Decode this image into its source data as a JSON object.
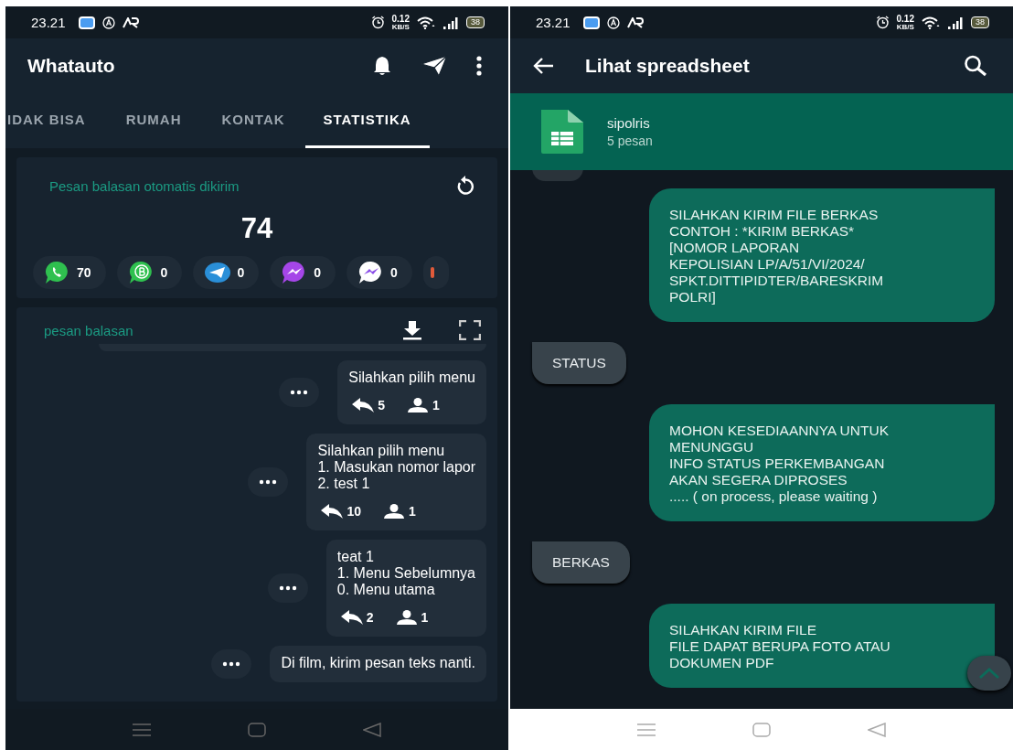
{
  "left_screen": {
    "status_bar": {
      "time": "23.21",
      "speed": "0.12",
      "speed_unit": "KB/S",
      "battery": "38"
    },
    "app_bar": {
      "title": "Whatauto"
    },
    "tabs": [
      {
        "label": "IDAK BISA",
        "selected": false
      },
      {
        "label": "RUMAH",
        "selected": false
      },
      {
        "label": "KONTAK",
        "selected": false
      },
      {
        "label": "STATISTIKA",
        "selected": true
      }
    ],
    "stats_card": {
      "title": "Pesan balasan otomatis dikirim",
      "total": "74",
      "platforms": [
        {
          "kind": "whatsapp",
          "count": "70"
        },
        {
          "kind": "business",
          "count": "0"
        },
        {
          "kind": "telegram",
          "count": "0"
        },
        {
          "kind": "messenger",
          "count": "0"
        },
        {
          "kind": "messenger_lite",
          "count": "0"
        },
        {
          "kind": "partial"
        }
      ]
    },
    "replies_card": {
      "title": "pesan balasan",
      "messages": [
        {
          "lines": [
            "Silahkan pilih menu"
          ],
          "replies": "5",
          "users": "1"
        },
        {
          "lines": [
            "Silahkan pilih menu",
            "1. Masukan nomor lapor",
            "2. test 1"
          ],
          "replies": "10",
          "users": "1"
        },
        {
          "lines": [
            "teat 1",
            "1. Menu Sebelumnya",
            "0. Menu utama"
          ],
          "replies": "2",
          "users": "1"
        },
        {
          "lines": [
            "Di film, kirim pesan teks nanti."
          ]
        }
      ]
    }
  },
  "right_screen": {
    "status_bar": {
      "time": "23.21",
      "speed": "0.12",
      "speed_unit": "KB/S",
      "battery": "38"
    },
    "app_bar": {
      "title": "Lihat spreadsheet"
    },
    "sheet": {
      "name": "sipolris",
      "count": "5 pesan"
    },
    "messages": [
      {
        "kind": "outgoing",
        "lines": [
          "SILAHKAN KIRIM FILE BERKAS",
          "CONTOH : *KIRIM BERKAS*",
          "[NOMOR LAPORAN",
          "KEPOLISIAN LP/A/51/VI/2024/",
          "SPKT.DITTIPIDTER/BARESKRIM",
          "POLRI]"
        ]
      },
      {
        "kind": "incoming",
        "lines": [
          "STATUS"
        ]
      },
      {
        "kind": "outgoing",
        "lines": [
          "MOHON KESEDIAANNYA UNTUK",
          "MENUNGGU",
          "INFO STATUS PERKEMBANGAN",
          "AKAN SEGERA DIPROSES",
          "..... ( on process, please waiting )"
        ]
      },
      {
        "kind": "incoming",
        "lines": [
          "BERKAS"
        ]
      },
      {
        "kind": "outgoing",
        "lines": [
          "SILAHKAN KIRIM FILE",
          "FILE DAPAT BERUPA FOTO ATAU",
          "DOKUMEN PDF"
        ]
      }
    ]
  }
}
